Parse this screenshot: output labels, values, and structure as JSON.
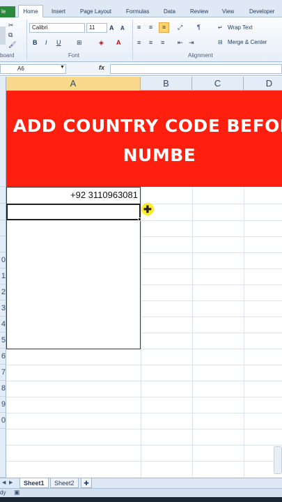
{
  "ribbon": {
    "tabs": [
      "File",
      "Home",
      "Insert",
      "Page Layout",
      "Formulas",
      "Data",
      "Review",
      "View",
      "Developer"
    ],
    "file_tab": "le",
    "font": {
      "name": "Calibri",
      "size": "11",
      "bold": "B",
      "italic": "I",
      "underline": "U",
      "grow": "A",
      "shrink": "A",
      "color_a": "A"
    },
    "alignment": {
      "wrap_text": "Wrap Text",
      "merge_center": "Merge & Center"
    },
    "group_labels": {
      "clipboard": "board",
      "font": "Font",
      "alignment": "Alignment"
    }
  },
  "formula_bar": {
    "name_box": "A6",
    "fx": "fx",
    "value": ""
  },
  "sheet": {
    "columns": [
      "A",
      "B",
      "C",
      "D"
    ],
    "banner_text": "ADD COUNTRY CODE BEFORE NUMBE",
    "cell_a5": "+92 3110963081",
    "active_cell": "A6",
    "row_labels": [
      "",
      "",
      "",
      "",
      "",
      "0",
      "1",
      "2",
      "3",
      "4",
      "5",
      "6",
      "7",
      "8",
      "9",
      "0"
    ]
  },
  "sheet_tabs": [
    "Sheet1",
    "Sheet2"
  ],
  "status": {
    "mode": "dy"
  }
}
